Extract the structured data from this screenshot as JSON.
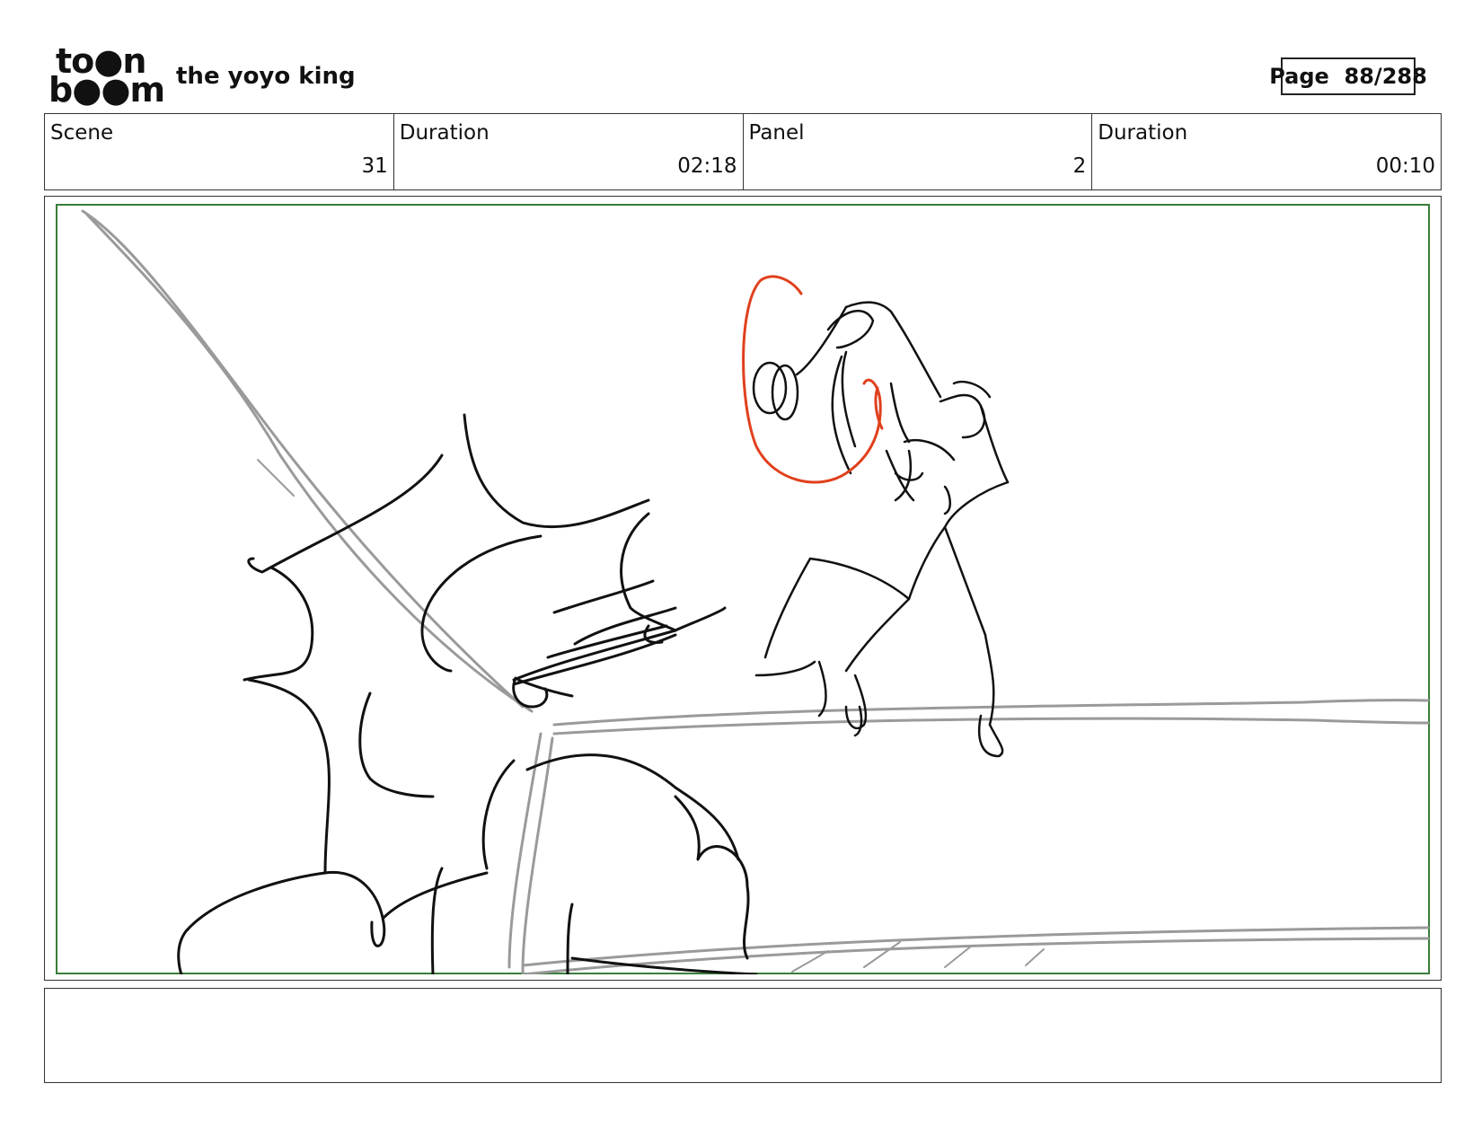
{
  "logo": {
    "line1": "to●n",
    "line2": "b●●m"
  },
  "header": {
    "project_title": "the yoyo king",
    "page_label": "Page",
    "page_number": "88/288"
  },
  "info": {
    "scene_label": "Scene",
    "scene_value": "31",
    "scene_duration_label": "Duration",
    "scene_duration_value": "02:18",
    "panel_label": "Panel",
    "panel_value": "2",
    "panel_duration_label": "Duration",
    "panel_duration_value": "00:10"
  },
  "colors": {
    "frame_border": "#3a7d3a",
    "sketch_black": "#111111",
    "sketch_gray": "#9a9a9a",
    "sketch_red": "#e0401c"
  },
  "notes": {
    "text": ""
  }
}
